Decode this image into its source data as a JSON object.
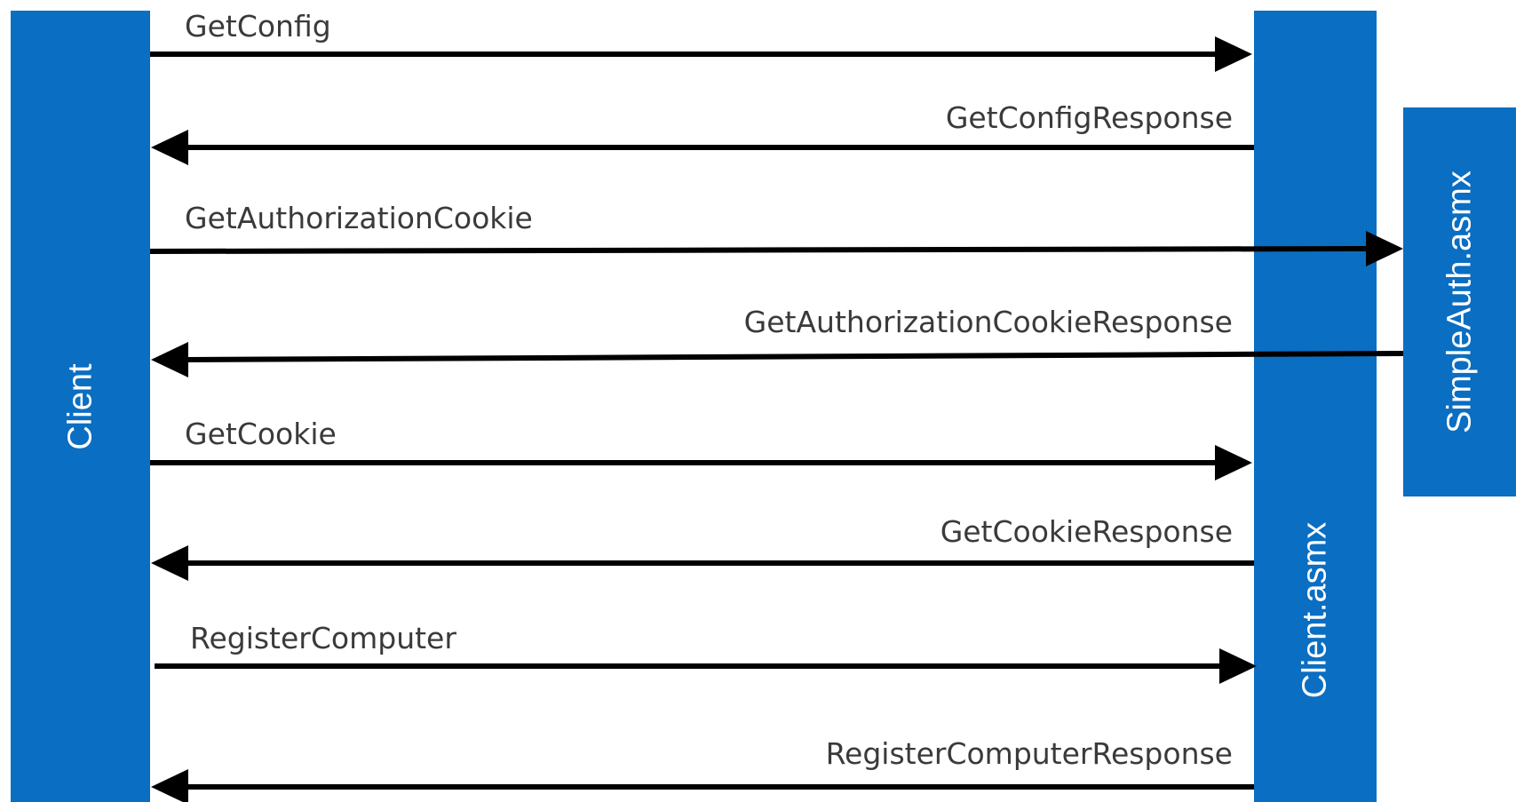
{
  "colors": {
    "lane": "#0A6EC2",
    "lane_text": "#ffffff",
    "arrow": "#000000",
    "label": "#3a3a3a"
  },
  "lanes": {
    "client": "Client",
    "client_asmx": "Client.asmx",
    "simpleauth_asmx": "SimpleAuth.asmx"
  },
  "messages": [
    {
      "label": "GetConfig",
      "from": "Client",
      "to": "Client.asmx"
    },
    {
      "label": "GetConfigResponse",
      "from": "Client.asmx",
      "to": "Client"
    },
    {
      "label": "GetAuthorizationCookie",
      "from": "Client",
      "to": "SimpleAuth.asmx"
    },
    {
      "label": "GetAuthorizationCookieResponse",
      "from": "SimpleAuth.asmx",
      "to": "Client"
    },
    {
      "label": "GetCookie",
      "from": "Client",
      "to": "Client.asmx"
    },
    {
      "label": "GetCookieResponse",
      "from": "Client.asmx",
      "to": "Client"
    },
    {
      "label": "RegisterComputer",
      "from": "Client",
      "to": "Client.asmx"
    },
    {
      "label": "RegisterComputerResponse",
      "from": "Client.asmx",
      "to": "Client"
    }
  ]
}
